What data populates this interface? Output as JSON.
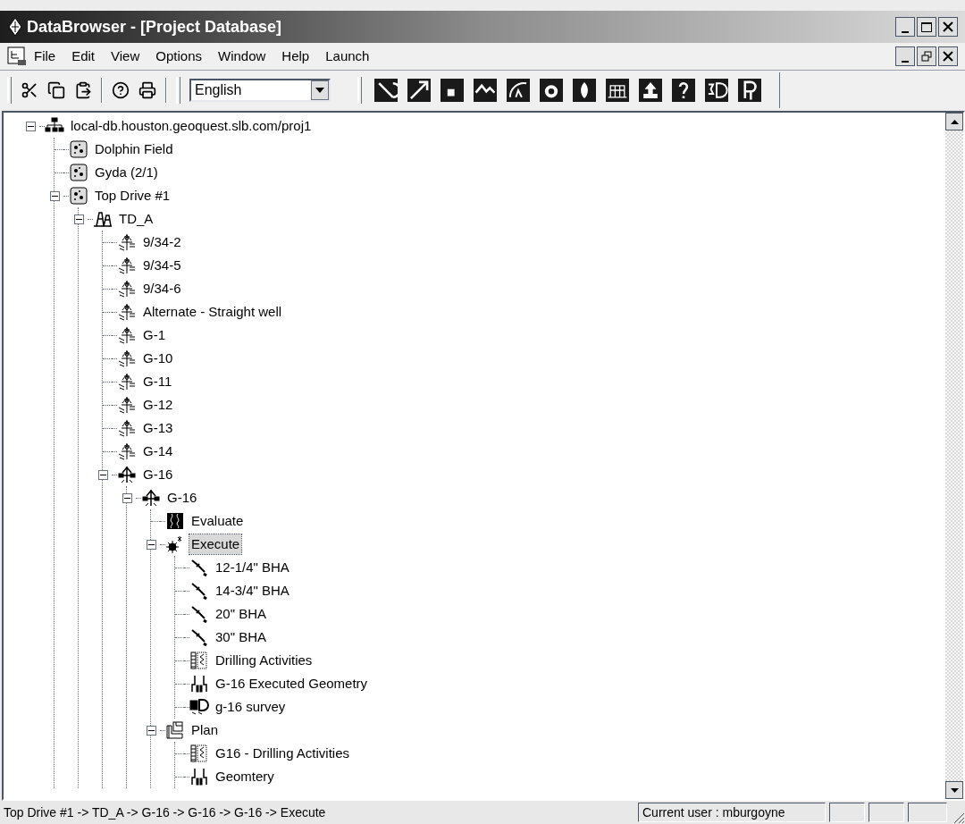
{
  "window": {
    "title": "DataBrowser - [Project Database]"
  },
  "menu": [
    "File",
    "Edit",
    "View",
    "Options",
    "Window",
    "Help",
    "Launch"
  ],
  "toolbar": {
    "language": "English"
  },
  "tree": [
    {
      "label": "local-db.houston.geoquest.slb.com/proj1",
      "kind": "server",
      "expanded": true,
      "selected": false,
      "children": [
        {
          "label": "Dolphin Field",
          "kind": "field",
          "selected": false
        },
        {
          "label": "Gyda (2/1)",
          "kind": "field",
          "selected": false
        },
        {
          "label": "Top Drive #1",
          "kind": "field",
          "expanded": true,
          "selected": false,
          "children": [
            {
              "label": "TD_A",
              "kind": "platform",
              "expanded": true,
              "selected": false,
              "children": [
                {
                  "label": "9/34-2",
                  "kind": "well",
                  "selected": false
                },
                {
                  "label": "9/34-5",
                  "kind": "well",
                  "selected": false
                },
                {
                  "label": "9/34-6",
                  "kind": "well",
                  "selected": false
                },
                {
                  "label": "Alternate - Straight well",
                  "kind": "well",
                  "selected": false
                },
                {
                  "label": "G-1",
                  "kind": "well",
                  "selected": false
                },
                {
                  "label": "G-10",
                  "kind": "well",
                  "selected": false
                },
                {
                  "label": "G-11",
                  "kind": "well",
                  "selected": false
                },
                {
                  "label": "G-12",
                  "kind": "well",
                  "selected": false
                },
                {
                  "label": "G-13",
                  "kind": "well",
                  "selected": false
                },
                {
                  "label": "G-14",
                  "kind": "well",
                  "selected": false
                },
                {
                  "label": "G-16",
                  "kind": "wellbore",
                  "expanded": true,
                  "selected": false,
                  "children": [
                    {
                      "label": "G-16",
                      "kind": "wellbore",
                      "expanded": true,
                      "selected": false,
                      "children": [
                        {
                          "label": "Evaluate",
                          "kind": "evaluate",
                          "selected": false
                        },
                        {
                          "label": "Execute",
                          "kind": "execute",
                          "expanded": true,
                          "selected": true,
                          "children": [
                            {
                              "label": "12-1/4\" BHA",
                              "kind": "bha",
                              "selected": false
                            },
                            {
                              "label": "14-3/4\" BHA",
                              "kind": "bha",
                              "selected": false
                            },
                            {
                              "label": "20\" BHA",
                              "kind": "bha",
                              "selected": false
                            },
                            {
                              "label": "30\" BHA",
                              "kind": "bha",
                              "selected": false
                            },
                            {
                              "label": "Drilling Activities",
                              "kind": "activities",
                              "selected": false
                            },
                            {
                              "label": "G-16 Executed Geometry",
                              "kind": "geometry",
                              "selected": false
                            },
                            {
                              "label": "g-16 survey",
                              "kind": "survey",
                              "selected": false
                            }
                          ]
                        },
                        {
                          "label": "Plan",
                          "kind": "plan",
                          "expanded": true,
                          "selected": false,
                          "children": [
                            {
                              "label": "G16 - Drilling Activities",
                              "kind": "activities",
                              "selected": false
                            },
                            {
                              "label": "Geomtery",
                              "kind": "geometry",
                              "selected": false
                            }
                          ]
                        }
                      ]
                    }
                  ]
                }
              ]
            }
          ]
        }
      ]
    }
  ],
  "status_bar": {
    "path": "Top Drive #1 -> TD_A -> G-16 -> G-16 -> G-16 -> Execute",
    "user": "Current user : mburgoyne"
  }
}
